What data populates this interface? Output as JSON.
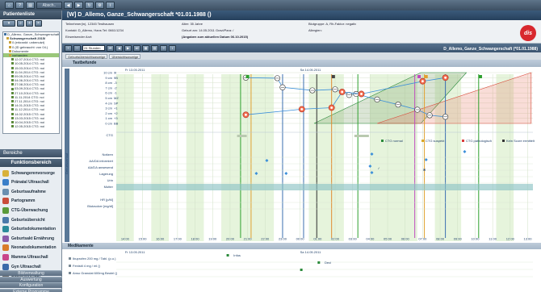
{
  "topbar": {
    "user_button": "Absch.."
  },
  "sidebar": {
    "title": "Patientenliste",
    "tree": [
      {
        "label": "D_Allemo, Ganze_Schwangerschaft",
        "level": 0,
        "bold": false
      },
      {
        "label": "Schwangerschaft 2015/",
        "level": 1,
        "bold": true
      },
      {
        "label": "0 (erkrankt: unbenutzt)",
        "level": 2,
        "bold": false
      },
      {
        "label": "0 (ID gebraucht: von 04.)",
        "level": 2,
        "bold": false
      },
      {
        "label": "Dokumente",
        "level": 2,
        "bold": false
      },
      {
        "label": "vorhanden",
        "level": 2,
        "bold": false
      },
      {
        "label": "12.07.2014 CTG: noi",
        "level": 3,
        "bold": false
      },
      {
        "label": "10.05.2014 CTG: noi",
        "level": 3,
        "bold": false
      },
      {
        "label": "15.03.2014 CTG: noi",
        "level": 3,
        "bold": false
      },
      {
        "label": "11.04.2014 CTG: noi",
        "level": 3,
        "bold": false
      },
      {
        "label": "09.05.2014 CTG: noi",
        "level": 3,
        "bold": false
      },
      {
        "label": "04.06.2014 CTG: noi",
        "level": 3,
        "bold": false
      },
      {
        "label": "27.08.2014 CTG: noi",
        "level": 3,
        "bold": false
      },
      {
        "label": "03.09.2014 CTG: noi",
        "level": 3,
        "bold": false
      },
      {
        "label": "27.10.2014 CTG: noi",
        "level": 3,
        "bold": false
      },
      {
        "label": "11.11.2014 CTG: noi",
        "level": 3,
        "bold": false
      },
      {
        "label": "27.11.2014 CTG: noi",
        "level": 3,
        "bold": false
      },
      {
        "label": "14.01.2015 CTG: noi",
        "level": 3,
        "bold": false
      },
      {
        "label": "11.12.2014 CTG: noi",
        "level": 3,
        "bold": false
      },
      {
        "label": "14.02.2015 CTG: noi",
        "level": 3,
        "bold": false
      },
      {
        "label": "13.03.2015 CTG: noi",
        "level": 3,
        "bold": false
      },
      {
        "label": "10.04.2015 CTG: noi",
        "level": 3,
        "bold": false
      },
      {
        "label": "12.05.2015 CTG: noi",
        "level": 3,
        "bold": false
      }
    ],
    "bereiche": "Bereiche",
    "funktionsbereich": "Funktionsbereich",
    "items": [
      {
        "label": "Schwangerenvorsorge",
        "color": "#d8b13a"
      },
      {
        "label": "Pränatal Ultraschall",
        "color": "#3a7fc9"
      },
      {
        "label": "Geburtsaufnahme",
        "color": "#6a8fb0"
      },
      {
        "label": "Partogramm",
        "color": "#c94c3a"
      },
      {
        "label": "CTG-Überwachung",
        "color": "#5a9a3a"
      },
      {
        "label": "Geburtsübersicht",
        "color": "#4a79a9"
      },
      {
        "label": "Geburtsdokumentation",
        "color": "#2a8a9a"
      },
      {
        "label": "Geburtsakt Ernährung",
        "color": "#8a5aa9"
      },
      {
        "label": "Neonatsdokumentation",
        "color": "#d97c2a"
      },
      {
        "label": "Mamma Ultraschall",
        "color": "#c9468a"
      },
      {
        "label": "Gyn Ultraschall",
        "color": "#3a6aa9"
      },
      {
        "label": "Stationsverlauf",
        "color": "#6a6a6a"
      }
    ],
    "bottom_buttons": [
      "Bildverwaltung",
      "Auswertung",
      "Konfiguration",
      "Externe Programme"
    ]
  },
  "header": {
    "title": "[W] D_Allemo, Ganze_Schwangerschaft *01.01.1988 ()",
    "info": {
      "line1a": "Teilnehmer(in), 12345 Testhausen",
      "line1b": "Alter: 35 Jahre",
      "line1c": "Blutgruppe: A, Rh-Faktor: negativ",
      "line2a": "Kontakt: D_Allemo, Hans  Tel: 0661/1234",
      "line2b": "Geburt am: 14.05.2011   Gravi/Para: /",
      "line2c": "Allergien:",
      "line3a": "Einweisender Arzt:",
      "line3b": "(Angaben zum aktuellen Datum 06.10.2015)"
    },
    "logo": "dis",
    "range_select": "24 Stunden",
    "patient_right": "D_Allemo, Ganze_Schwangerschaft (*01.01.1988)"
  },
  "view_tabs": [
    "Geburtsübersichtsanzeige",
    "Übersichtsanzeige"
  ],
  "section_title": "Tastbefunde",
  "section2_title": "Medikamente",
  "date_left": "Fr 13.05.2011",
  "date_right": "Sa 14.05.2011",
  "side_caption": "Geburtsverlauf",
  "chart_data": {
    "type": "line",
    "y_ticks": [
      "10 cm",
      "9 cm",
      "8 cm",
      "7 cm",
      "6 cm",
      "5 cm",
      "4 cm",
      "3 cm",
      "2 cm",
      "1 cm",
      "0 cm"
    ],
    "y_right_ticks": [
      "9I",
      "9B",
      "-3",
      "-2",
      "-1",
      "MZ",
      "SP",
      "+1",
      "+2",
      "+3",
      "BB"
    ],
    "time_ticks": [
      "14:00",
      "15:00",
      "16:00",
      "17:00",
      "18:00",
      "19:00",
      "20:00",
      "21:00",
      "22:00",
      "23:00",
      "00:00",
      "01:00",
      "02:00",
      "03:00",
      "04:00",
      "05:00",
      "06:00",
      "07:00",
      "08:00",
      "09:00",
      "10:00",
      "11:00",
      "12:00",
      "13:00"
    ],
    "ylim": [
      0,
      10
    ],
    "series": [
      {
        "color": "#3b8fd9",
        "x": [
          20.9,
          22.7,
          23.0,
          24.7,
          26.0,
          26.8,
          27.2,
          28.4,
          29.6,
          30.7,
          31.4,
          32.3
        ],
        "values": [
          9.0,
          8.9,
          7.1,
          6.5,
          6.7,
          5.6,
          5.8,
          4.7,
          3.7,
          2.7,
          1.6,
          1.3
        ]
      },
      {
        "color": "#3b8fd9",
        "x": [
          20.9,
          24.1,
          25.8,
          26.4,
          27.5,
          31.0,
          32.3
        ],
        "values": [
          1.7,
          2.8,
          3.1,
          6.2,
          5.8,
          8.3,
          9.0
        ]
      }
    ],
    "rows": [
      "Notizen",
      "AA/DA informiert",
      "AA/DA anwesend",
      "Lagerung",
      "Urin",
      "Mutter",
      "HR [p/M]",
      "Blutzucker [mg/dl]"
    ],
    "medication_rows": [
      "Ibuprofen 200 mg / Tabl. (p.o.)",
      "Fenistil 4 mg / ml ()",
      "Anso Granulat 600mg Beutel ()"
    ],
    "medication_labels": [
      "Infus",
      "Deci"
    ],
    "legend": [
      {
        "label": "CTG normal",
        "color": "#2a8a3a"
      },
      {
        "label": "CTG suspekt",
        "color": "#d9a92a"
      },
      {
        "label": "CTG pathologisch",
        "color": "#d93a3a"
      },
      {
        "label": "Kein Score ermittelt",
        "color": "#333333"
      }
    ],
    "ctg_row": "CTG"
  }
}
